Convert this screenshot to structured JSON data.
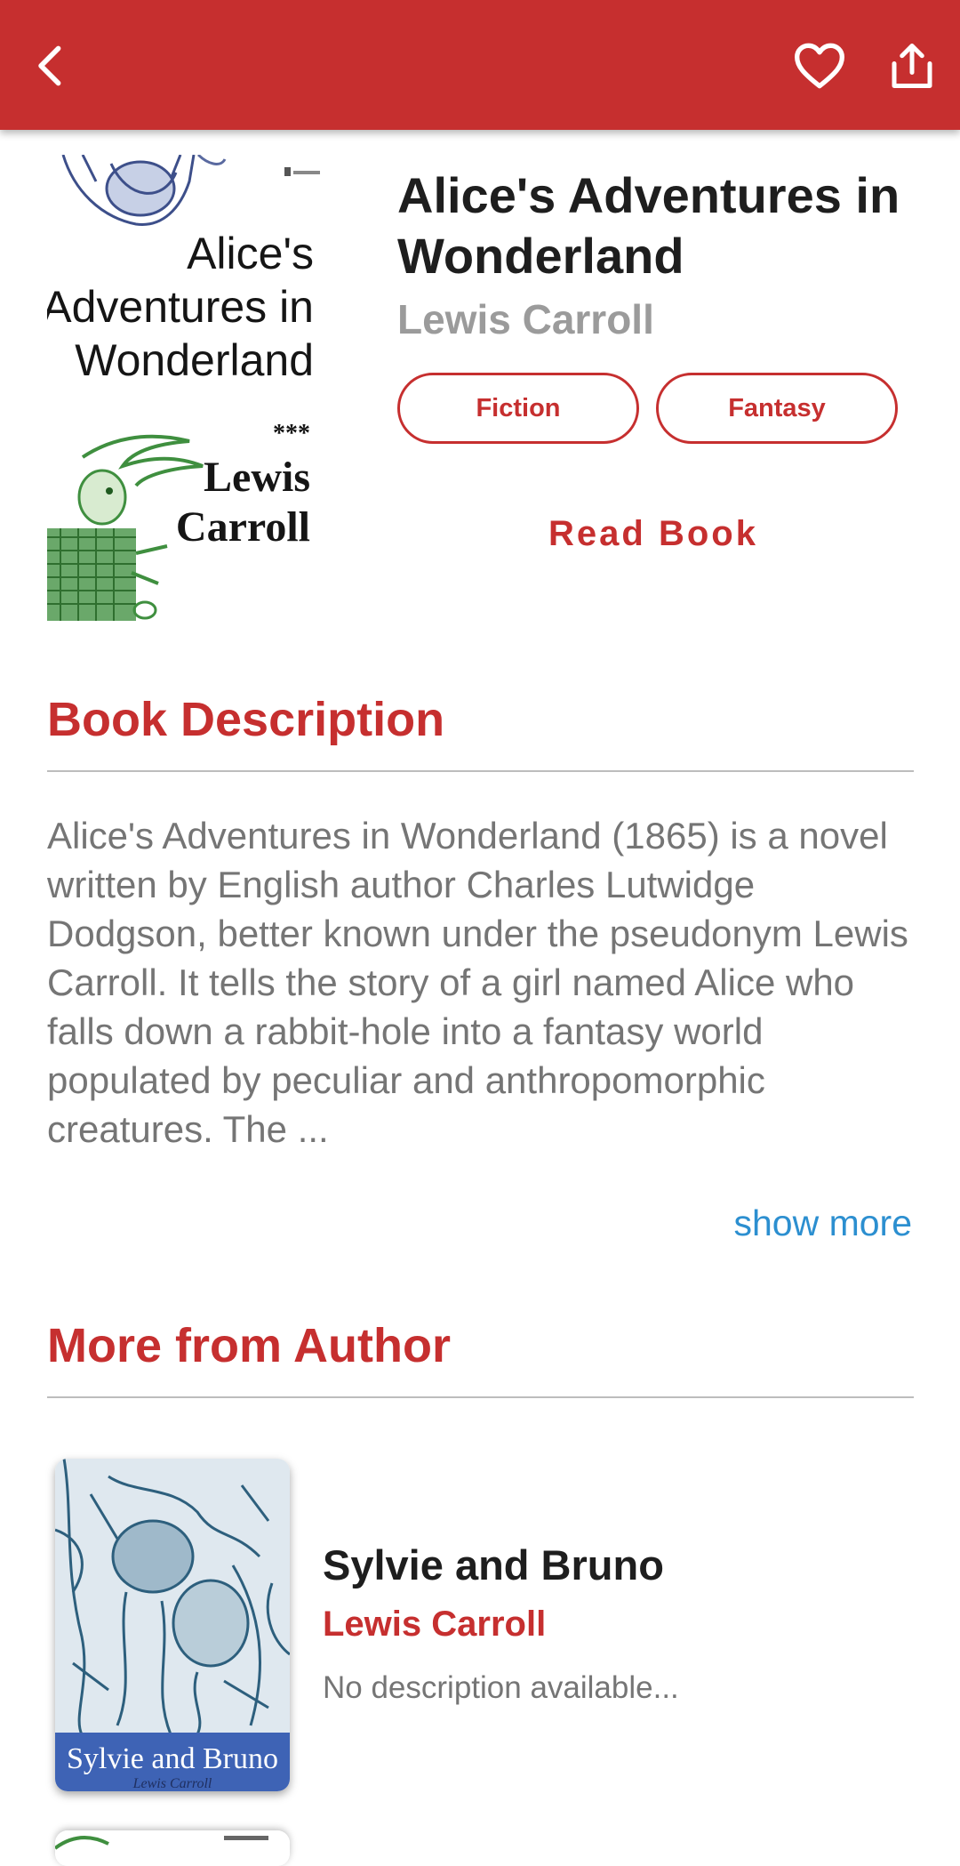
{
  "app_bar": {
    "back_icon": "chevron-left-icon",
    "favorite_icon": "heart-outline-icon",
    "share_icon": "share-icon",
    "color": "#c62f2f"
  },
  "book": {
    "title": "Alice's Adventures in Wonderland",
    "author": "Lewis Carroll",
    "cover": {
      "title_lines": [
        "Alice's",
        "Adventures in",
        "Wonderland"
      ],
      "separator": "***",
      "author_lines": [
        "Lewis",
        "Carroll"
      ]
    },
    "genres": [
      "Fiction",
      "Fantasy"
    ],
    "read_label": "Read Book"
  },
  "description_section": {
    "title": "Book Description",
    "text": "Alice's Adventures in Wonderland (1865) is a novel written by English author Charles Lutwidge Dodgson, better known under the pseudonym Lewis Carroll. It tells the story of a girl named Alice who falls down a rabbit-hole into a fantasy world populated by peculiar and anthropomorphic creatures. The ...",
    "show_more": "show more"
  },
  "more_section": {
    "title": "More from Author",
    "items": [
      {
        "title": "Sylvie and Bruno",
        "author": "Lewis Carroll",
        "description": "No description available...",
        "cover_caption": "Sylvie and Bruno",
        "cover_subcaption": "Lewis Carroll"
      }
    ]
  },
  "colors": {
    "accent": "#c62f2f",
    "link": "#2c8fd0",
    "muted_text": "#757575"
  }
}
